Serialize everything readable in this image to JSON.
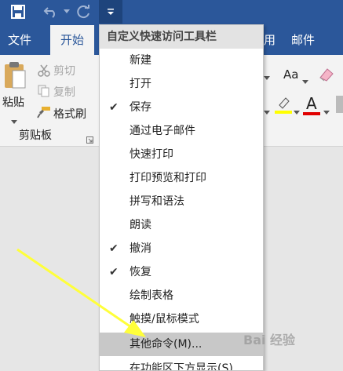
{
  "ribbon_tabs": {
    "file": "文件",
    "home": "开始",
    "mail": "邮件",
    "partial_left": "用"
  },
  "clipboard": {
    "paste": "粘贴",
    "cut": "剪切",
    "copy": "复制",
    "format_painter": "格式刷",
    "group_label": "剪贴板"
  },
  "font_tools": {
    "change_case": "Aa",
    "font_color_letter": "A",
    "highlight_color": "#ffff00",
    "font_color": "#e00000"
  },
  "qat_menu": {
    "title": "自定义快速访问工具栏",
    "items": [
      {
        "label": "新建",
        "checked": false
      },
      {
        "label": "打开",
        "checked": false
      },
      {
        "label": "保存",
        "checked": true
      },
      {
        "label": "通过电子邮件",
        "checked": false
      },
      {
        "label": "快速打印",
        "checked": false
      },
      {
        "label": "打印预览和打印",
        "checked": false
      },
      {
        "label": "拼写和语法",
        "checked": false
      },
      {
        "label": "朗读",
        "checked": false
      },
      {
        "label": "撤消",
        "checked": true
      },
      {
        "label": "恢复",
        "checked": true
      },
      {
        "label": "绘制表格",
        "checked": false
      },
      {
        "label": "触摸/鼠标模式",
        "checked": false
      },
      {
        "label": "其他命令(M)...",
        "checked": false,
        "highlighted": true
      },
      {
        "label": "在功能区下方显示(S)",
        "checked": false
      }
    ],
    "check_glyph": "✔"
  },
  "watermark": "Bai 经验",
  "colors": {
    "title_bar": "#2b579a",
    "menu_highlight": "#c8c8c8",
    "arrow": "#ffff3a"
  }
}
